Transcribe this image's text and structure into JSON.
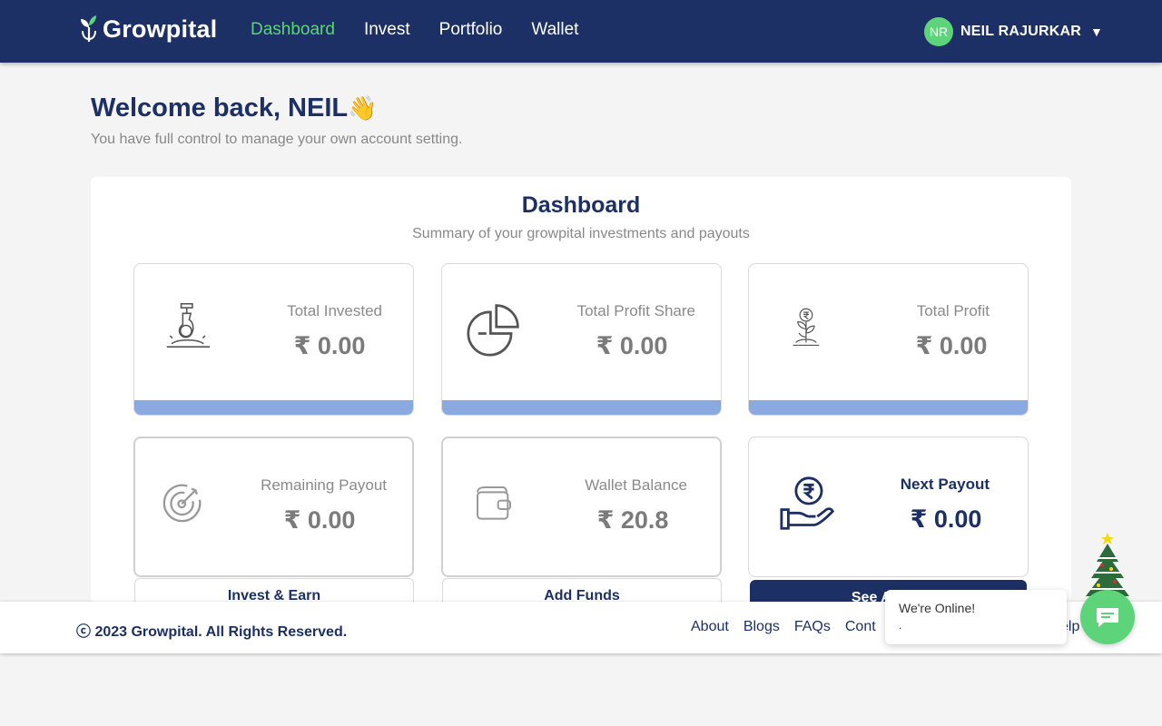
{
  "brand": {
    "name": "Growpital",
    "accent": "#5ed47a",
    "primary": "#1c3066"
  },
  "nav": {
    "items": [
      {
        "label": "Dashboard",
        "active": true
      },
      {
        "label": "Invest"
      },
      {
        "label": "Portfolio"
      },
      {
        "label": "Wallet"
      }
    ]
  },
  "user": {
    "initials": "NR",
    "name": "NEIL RAJURKAR",
    "caret": "▼"
  },
  "welcome": {
    "title": "Welcome back, NEIL",
    "emoji": "👋",
    "subtitle": "You have full control to manage your own account setting."
  },
  "dashboard": {
    "title": "Dashboard",
    "subtitle": "Summary of your growpital investments and payouts",
    "stats": [
      {
        "label": "Total Invested",
        "value": "₹ 0.00",
        "icon": "investment-plant-icon"
      },
      {
        "label": "Total Profit Share",
        "value": "₹ 0.00",
        "icon": "pie-chart-icon"
      },
      {
        "label": "Total Profit",
        "value": "₹ 0.00",
        "icon": "rupee-plant-icon"
      },
      {
        "label": "Remaining Payout",
        "value": "₹ 0.00",
        "icon": "target-icon"
      },
      {
        "label": "Wallet Balance",
        "value": "₹ 20.8",
        "icon": "wallet-icon"
      },
      {
        "label": "Next Payout",
        "value": "₹ 0.00",
        "icon": "hand-rupee-icon"
      }
    ],
    "actions": [
      {
        "label": "Invest & Earn"
      },
      {
        "label": "Add Funds"
      },
      {
        "label": "See All Tra"
      }
    ]
  },
  "footer": {
    "copyright": "ⓒ 2023 Growpital. All Rights Reserved.",
    "links": [
      "About",
      "Blogs",
      "FAQs",
      "Cont"
    ],
    "trailing": "elp"
  },
  "chat": {
    "title": "We're Online!",
    "status": "."
  }
}
